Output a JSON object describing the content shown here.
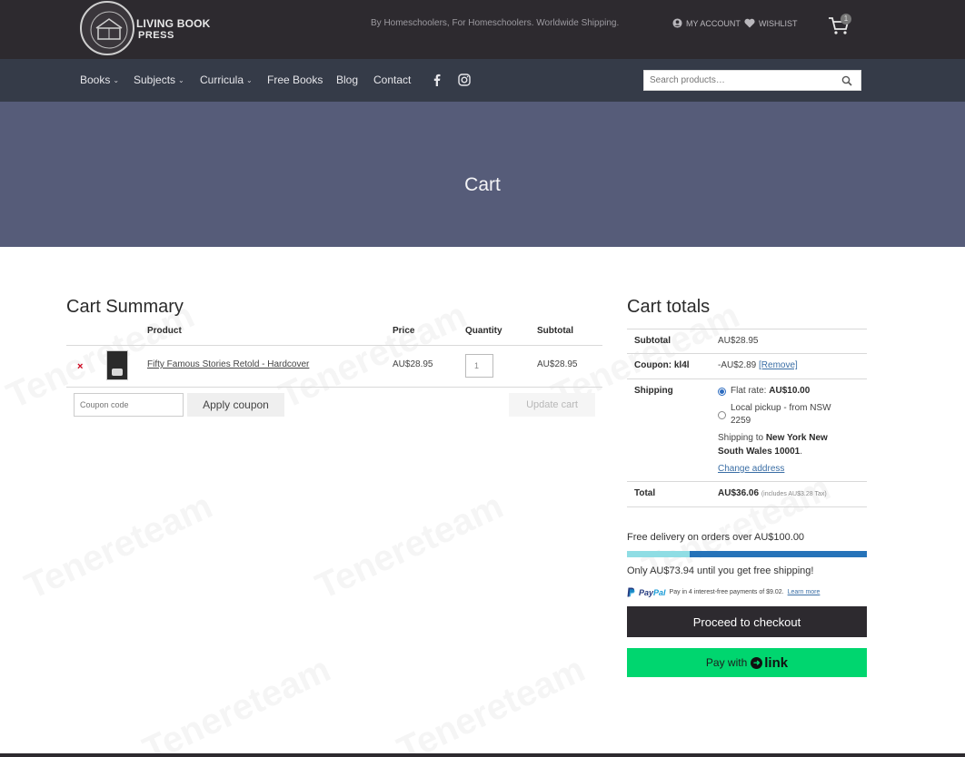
{
  "header": {
    "logo_line1": "LIVING BOOK",
    "logo_line2": "PRESS",
    "tagline": "By Homeschoolers, For Homeschoolers. Worldwide Shipping.",
    "account_label": "MY ACCOUNT",
    "wishlist_label": "WISHLIST",
    "cart_count": "1"
  },
  "nav": {
    "items": [
      {
        "label": "Books",
        "has_dropdown": true
      },
      {
        "label": "Subjects",
        "has_dropdown": true
      },
      {
        "label": "Curricula",
        "has_dropdown": true
      },
      {
        "label": "Free Books",
        "has_dropdown": false
      },
      {
        "label": "Blog",
        "has_dropdown": false
      },
      {
        "label": "Contact",
        "has_dropdown": false
      }
    ],
    "social_icons": [
      "facebook-icon",
      "instagram-icon"
    ],
    "chevron": "⌄",
    "search_placeholder": "Search products…"
  },
  "hero": {
    "title": "Cart"
  },
  "watermark": "Tenereteam",
  "cart_summary": {
    "title": "Cart Summary",
    "columns": {
      "product": "Product",
      "price": "Price",
      "quantity": "Quantity",
      "subtotal": "Subtotal"
    },
    "rows": [
      {
        "remove": "×",
        "name": "Fifty Famous Stories Retold - Hardcover",
        "price": "AU$28.95",
        "quantity": "1",
        "subtotal": "AU$28.95"
      }
    ],
    "coupon_placeholder": "Coupon code",
    "apply_coupon_label": "Apply coupon",
    "update_cart_label": "Update cart"
  },
  "cart_totals": {
    "title": "Cart totals",
    "subtotal_label": "Subtotal",
    "subtotal_value": "AU$28.95",
    "coupon_label": "Coupon: kl4l",
    "coupon_value": "-AU$2.89",
    "coupon_remove": "[Remove]",
    "shipping_label": "Shipping",
    "shipping_options": [
      {
        "text": "Flat rate:",
        "amount": "AU$10.00",
        "selected": true
      },
      {
        "text": "Local pickup - from NSW",
        "text2": "2259",
        "selected": false
      }
    ],
    "shipping_to_prefix": "Shipping to",
    "shipping_to_place": "New York New",
    "shipping_to_place2": "South Wales 10001",
    "shipping_to_suffix": ".",
    "change_address": "Change address",
    "total_label": "Total",
    "total_value": "AU$36.06",
    "total_tax": "(includes AU$3.28 Tax)"
  },
  "free_shipping": {
    "headline": "Free delivery on orders over AU$100.00",
    "remaining_text": "Only AU$73.94 until you get free shipping!",
    "progress_fraction": 0.26,
    "colors": {
      "fill": "#8fdde4",
      "track": "#2673b9"
    }
  },
  "paypal": {
    "brand_a": "Pay",
    "brand_b": "Pal",
    "message": "Pay in 4 interest-free payments of $9.02.",
    "learn_more": "Learn more"
  },
  "checkout": {
    "proceed_label": "Proceed to checkout",
    "pay_with": "Pay with",
    "link_brand": "link"
  },
  "colors": {
    "topbar": "#2d2a2f",
    "nav": "#353b48",
    "hero": "#565c79",
    "link_green": "#00d66f"
  }
}
